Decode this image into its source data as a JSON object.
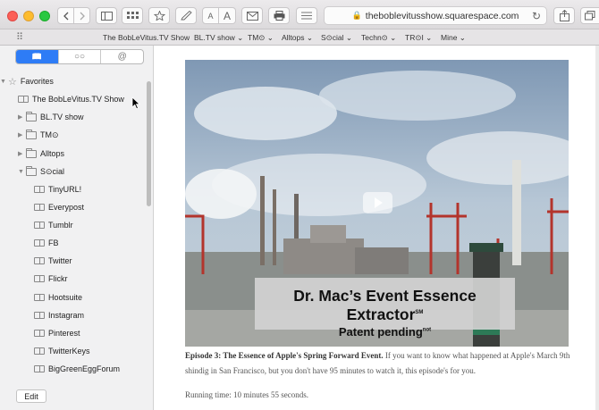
{
  "toolbar": {
    "reader_aa_small": "A",
    "reader_aa_large": "A",
    "url": "theboblevitusshow.squarespace.com"
  },
  "bookmarks_bar": {
    "items": [
      "The BobLeVitus.TV Show",
      "BL.TV show ⌄",
      "TM⊙ ⌄",
      "Alltops ⌄",
      "S⊙cial ⌄",
      "Techn⊙ ⌄",
      "TR⊙I ⌄",
      "Mine ⌄"
    ]
  },
  "sidebar": {
    "tabs": [
      "bookmarks",
      "reading-list",
      "shared-links"
    ],
    "tab_glyphs": [
      "📖",
      "○○",
      "@"
    ],
    "items": [
      {
        "label": "Favorites",
        "type": "favorites",
        "expanded": true,
        "indent": 0
      },
      {
        "label": "The BobLeVitus.TV Show",
        "type": "bookmark",
        "indent": 1
      },
      {
        "label": "BL.TV show",
        "type": "folder",
        "expanded": false,
        "indent": 1
      },
      {
        "label": "TM⊙",
        "type": "folder",
        "expanded": false,
        "indent": 1
      },
      {
        "label": "Alltops",
        "type": "folder",
        "expanded": false,
        "indent": 1
      },
      {
        "label": "S⊙cial",
        "type": "folder",
        "expanded": true,
        "indent": 1
      },
      {
        "label": "TinyURL!",
        "type": "bookmark",
        "indent": 2
      },
      {
        "label": "Everypost",
        "type": "bookmark",
        "indent": 2
      },
      {
        "label": "Tumblr",
        "type": "bookmark",
        "indent": 2
      },
      {
        "label": "FB",
        "type": "bookmark",
        "indent": 2
      },
      {
        "label": "Twitter",
        "type": "bookmark",
        "indent": 2
      },
      {
        "label": "Flickr",
        "type": "bookmark",
        "indent": 2
      },
      {
        "label": "Hootsuite",
        "type": "bookmark",
        "indent": 2
      },
      {
        "label": "Instagram",
        "type": "bookmark",
        "indent": 2
      },
      {
        "label": "Pinterest",
        "type": "bookmark",
        "indent": 2
      },
      {
        "label": "TwitterKeys",
        "type": "bookmark",
        "indent": 2
      },
      {
        "label": "BigGreenEggForum",
        "type": "bookmark",
        "indent": 2
      }
    ],
    "edit_label": "Edit"
  },
  "video": {
    "caption_line1": "Dr. Mac’s Event Essence Extractor",
    "caption_line1_sup": "SM",
    "caption_line2": "Patent pending",
    "caption_line2_sup": "not"
  },
  "article": {
    "title": "Episode 3: The Essence of Apple's Spring Forward Event",
    "title_suffix": ".",
    "body": " If you want to know what happened at Apple's March 9th shindig in San Francisco, but you don't have 95 minutes to watch it, this episode's for you.",
    "running_time": "Running time: 10 minutes 55 seconds."
  },
  "colors": {
    "accent": "#2e7cf6",
    "close": "#fc5f57",
    "minimize": "#fdbc2e",
    "zoom": "#28c840"
  }
}
